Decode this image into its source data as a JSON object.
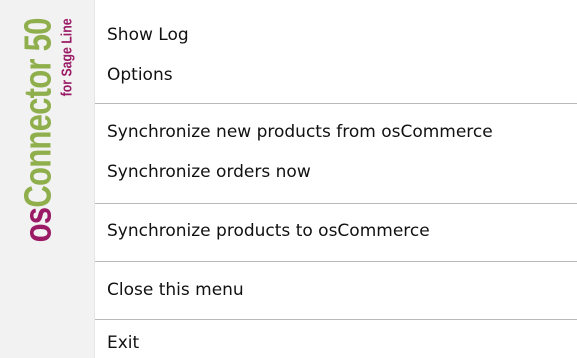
{
  "brand": {
    "name_prefix": "os",
    "name_rest": "Connector 50",
    "subtitle": "for Sage Line"
  },
  "colors": {
    "brand_purple": "#9a1a66",
    "brand_green": "#8fae4c",
    "separator": "#b9b9b9"
  },
  "menu": {
    "items": [
      {
        "label": "Show Log"
      },
      {
        "label": "Options"
      },
      {
        "label": "Synchronize new products from osCommerce"
      },
      {
        "label": "Synchronize orders now"
      },
      {
        "label": "Synchronize products to osCommerce"
      },
      {
        "label": "Close this menu"
      },
      {
        "label": "Exit"
      }
    ]
  }
}
